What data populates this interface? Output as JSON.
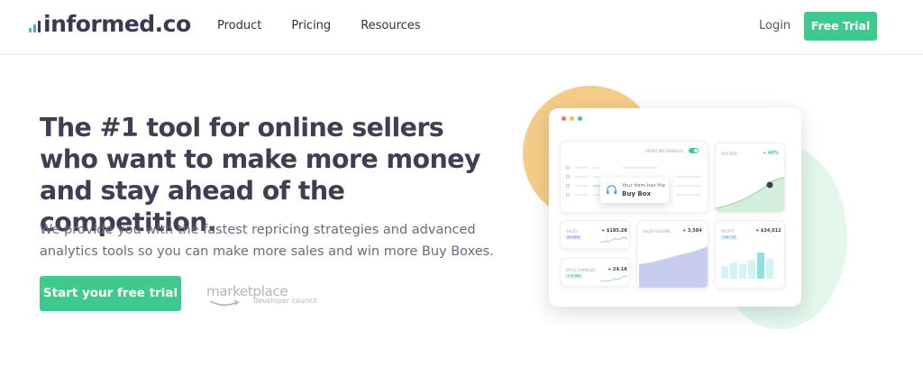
{
  "brand": {
    "name": "informed.co",
    "bar_colors": [
      "#40c98e",
      "#4aa6d9",
      "#3a3a4f"
    ]
  },
  "nav": {
    "items": [
      "Product",
      "Pricing",
      "Resources"
    ]
  },
  "header": {
    "login_label": "Login",
    "trial_label": "Free Trial"
  },
  "hero": {
    "headline": "The #1 tool for online sellers who want to make more money and stay ahead of the competition.",
    "subtext": "We provide you with the fastest repricing strategies and advanced analytics tools so you can make more sales and win more Buy Boxes.",
    "cta_label": "Start your free trial",
    "partner": {
      "main": "marketplace",
      "sub": "developer council"
    }
  },
  "dashboard": {
    "window_dots": [
      "#ff6b6b",
      "#f5c342",
      "#40c98e"
    ],
    "repricing_label": "REPRICING ENABLED",
    "popup": {
      "line1": "Your item has the",
      "line2": "Buy Box"
    },
    "buy_box": {
      "label": "BUY BOX",
      "value": "+ 46%"
    },
    "sales": {
      "label": "SALES",
      "badge": "$45,840",
      "value": "+ $185.2K"
    },
    "sales_volume": {
      "label": "SALES VOLUME",
      "value": "+ 3,584"
    },
    "profit": {
      "label": "PROFIT",
      "badge": "+$87.50",
      "value": "+ $34,012"
    },
    "price_changes": {
      "label": "PRICE CHANGES",
      "badge": "+34,864",
      "value": "+ 24.1K"
    },
    "colors": {
      "accent": "#40c98e",
      "orange_blob": "#f5cc87",
      "green_blob": "#e3f7ec",
      "purple_area": "#c7cdf0",
      "cyan_bars": "#bfeef0"
    }
  }
}
